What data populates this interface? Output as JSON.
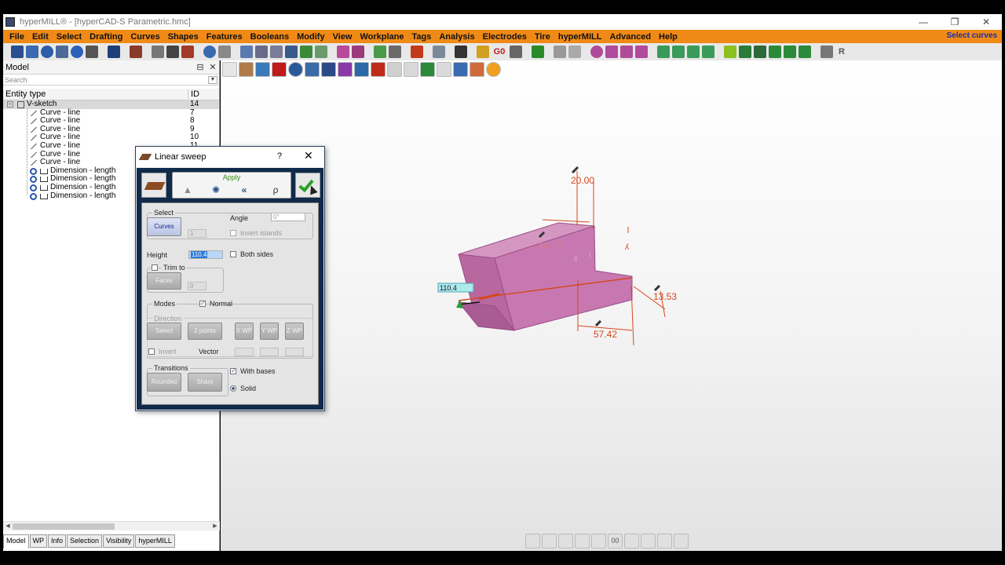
{
  "window": {
    "title": "hyperMILL® - [hyperCAD-S Parametric.hmc]",
    "controls": [
      "—",
      "❐",
      "✕"
    ]
  },
  "menu": {
    "items": [
      "File",
      "Edit",
      "Select",
      "Drafting",
      "Curves",
      "Shapes",
      "Features",
      "Booleans",
      "Modify",
      "View",
      "Workplane",
      "Tags",
      "Analysis",
      "Electrodes",
      "Tire",
      "hyperMILL",
      "Advanced",
      "Help"
    ],
    "status": "Select curves"
  },
  "toolbar_top": {
    "labels": [
      "G0",
      "R"
    ]
  },
  "model_panel": {
    "title": "Model",
    "pin": "⊟",
    "close": "✕",
    "search_placeholder": "Search",
    "columns": [
      "Entity type",
      "ID"
    ],
    "root": {
      "label": "V-sketch",
      "id": "14"
    },
    "rows": [
      {
        "label": "Curve - line",
        "id": "7",
        "type": "line"
      },
      {
        "label": "Curve - line",
        "id": "8",
        "type": "line"
      },
      {
        "label": "Curve - line",
        "id": "9",
        "type": "line"
      },
      {
        "label": "Curve - line",
        "id": "10",
        "type": "line"
      },
      {
        "label": "Curve - line",
        "id": "11",
        "type": "line"
      },
      {
        "label": "Curve - line",
        "id": "",
        "type": "line"
      },
      {
        "label": "Curve - line",
        "id": "",
        "type": "line"
      },
      {
        "label": "Dimension - length",
        "id": "",
        "type": "dim"
      },
      {
        "label": "Dimension - length",
        "id": "",
        "type": "dim"
      },
      {
        "label": "Dimension - length",
        "id": "",
        "type": "dim"
      },
      {
        "label": "Dimension - length",
        "id": "",
        "type": "dim"
      }
    ],
    "tabs": [
      "Model",
      "WP",
      "Info",
      "Selection",
      "Visibility",
      "hyperMILL"
    ]
  },
  "dialog": {
    "title": "Linear sweep",
    "help": "?",
    "close": "✕",
    "apply": "Apply",
    "select": {
      "group_label": "Select",
      "curves_button": "Curves",
      "count": "1",
      "angle_label": "Angle",
      "angle_value": "0°",
      "invert_islands": "Invert islands"
    },
    "height": {
      "label": "Height",
      "value": "110.4",
      "both_sides": "Both sides"
    },
    "trim": {
      "label": "Trim to",
      "faces_button": "Faces",
      "count": "0"
    },
    "modes": {
      "label": "Modes",
      "normal": "Normal",
      "direction_label": "Direction",
      "buttons": [
        "Select",
        "2 points",
        "X WP",
        "Y WP",
        "Z WP"
      ],
      "invert": "Invert",
      "vector": "Vector"
    },
    "transitions": {
      "label": "Transitions",
      "rounded": "Rounded",
      "sharp": "Sharp",
      "with_bases": "With bases",
      "solid": "Solid"
    }
  },
  "viewport": {
    "dimensions": [
      "20.00",
      "44.73",
      "57.42",
      "13.53"
    ],
    "height_tag": "110.4",
    "extra_marks": [
      "4",
      "\\",
      "ʎ"
    ],
    "bottom_toolbar_label": "00"
  },
  "colors": {
    "menu_bg": "#f08a16",
    "solid_fill": "#c778b0",
    "dimension": "#d5471c"
  }
}
